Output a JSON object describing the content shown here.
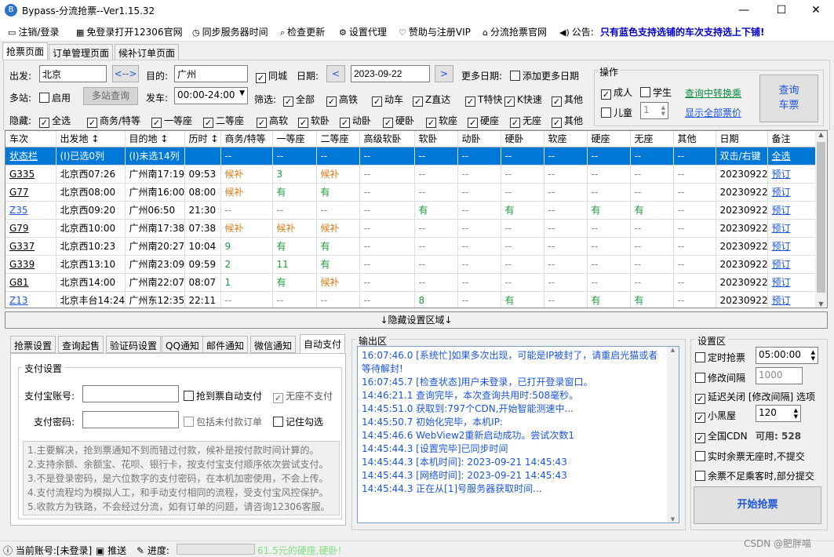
{
  "window": {
    "title": "Bypass-分流抢票--Ver1.15.32"
  },
  "menu": [
    {
      "label": "注销/登录",
      "icon": "login-icon"
    },
    {
      "label": "免登录打开12306官网",
      "icon": "window-icon"
    },
    {
      "label": "同步服务器时间",
      "icon": "clock-icon"
    },
    {
      "label": "检查更新",
      "icon": "search-icon"
    },
    {
      "label": "设置代理",
      "icon": "gear-icon"
    },
    {
      "label": "赞助与注册VIP",
      "icon": "heart-icon"
    },
    {
      "label": "分流抢票官网",
      "icon": "home-icon"
    },
    {
      "label": "公告:",
      "icon": "speaker-icon"
    }
  ],
  "notice": "只有蓝色支持选铺的车次支持选上下铺!",
  "tabs": [
    "抢票页面",
    "订单管理页面",
    "候补订单页面"
  ],
  "query": {
    "from_label": "出发:",
    "from": "北京",
    "swap": "<-->",
    "to_label": "目的:",
    "to": "广州",
    "samecity": "同城",
    "date_label": "日期:",
    "date": "2023-09-22",
    "prev": "<",
    "next": ">",
    "moredates_label": "更多日期:",
    "add_dates": "添加更多日期",
    "multi_label": "多站:",
    "enable": "启用",
    "multi_query": "多站查询",
    "depart_label": "发车:",
    "depart_range": "00:00-24:00",
    "filter_label": "筛选:",
    "filters": [
      "全部",
      "高铁",
      "动车",
      "Z直达",
      "T特快",
      "K快速",
      "其他"
    ],
    "hide_label": "隐藏:",
    "seats": [
      "全选",
      "商务/特等",
      "一等座",
      "二等座",
      "高软",
      "软卧",
      "动卧",
      "硬卧",
      "软座",
      "硬座",
      "无座",
      "其他"
    ],
    "ops_title": "操作",
    "adult": "成人",
    "student": "学生",
    "child": "儿童",
    "child_count": "1",
    "transfer_link": "查询中转换乘",
    "showprice_link": "显示全部票价",
    "query_button": "查询\n车票"
  },
  "table": {
    "headers": [
      "车次",
      "出发地 ↕",
      "目的地 ↕",
      "历时 ↕",
      "商务/特等",
      "一等座",
      "二等座",
      "高级软卧",
      "软卧",
      "动卧",
      "硬卧",
      "软座",
      "硬座",
      "无座",
      "其他",
      "日期",
      "备注"
    ],
    "status_row": [
      "状态栏",
      "(I)已选0列",
      "(I)未选14列",
      "",
      "--",
      "--",
      "--",
      "--",
      "--",
      "--",
      "--",
      "--",
      "--",
      "--",
      "--",
      "双击/右键",
      "全选"
    ],
    "rows": [
      [
        "G335",
        "北京西07:26",
        "广州南17:19",
        "09:53",
        "候补",
        "3",
        "候补",
        "--",
        "--",
        "--",
        "--",
        "--",
        "--",
        "--",
        "--",
        "20230922",
        "预订"
      ],
      [
        "G77",
        "北京西08:00",
        "广州南16:00",
        "08:00",
        "候补",
        "有",
        "有",
        "--",
        "--",
        "--",
        "--",
        "--",
        "--",
        "--",
        "--",
        "20230922",
        "预订"
      ],
      [
        "Z35",
        "北京西09:20",
        "广州06:50",
        "21:30",
        "--",
        "--",
        "--",
        "--",
        "有",
        "--",
        "有",
        "--",
        "有",
        "有",
        "--",
        "20230922",
        "预订"
      ],
      [
        "G79",
        "北京西10:00",
        "广州南17:38",
        "07:38",
        "候补",
        "候补",
        "候补",
        "--",
        "--",
        "--",
        "--",
        "--",
        "--",
        "--",
        "--",
        "20230922",
        "预订"
      ],
      [
        "G337",
        "北京西10:23",
        "广州南20:27",
        "10:04",
        "9",
        "有",
        "有",
        "--",
        "--",
        "--",
        "--",
        "--",
        "--",
        "--",
        "--",
        "20230922",
        "预订"
      ],
      [
        "G339",
        "北京西13:10",
        "广州南23:09",
        "09:59",
        "2",
        "11",
        "有",
        "--",
        "--",
        "--",
        "--",
        "--",
        "--",
        "--",
        "--",
        "20230922",
        "预订"
      ],
      [
        "G81",
        "北京西14:00",
        "广州南22:07",
        "08:07",
        "1",
        "有",
        "候补",
        "--",
        "--",
        "--",
        "--",
        "--",
        "--",
        "--",
        "--",
        "20230922",
        "预订"
      ],
      [
        "Z13",
        "北京丰台14:24",
        "广州东12:35",
        "22:11",
        "--",
        "--",
        "--",
        "--",
        "8",
        "--",
        "有",
        "--",
        "有",
        "有",
        "--",
        "20230922",
        "预订"
      ]
    ]
  },
  "hide_area": "↓隐藏设置区域↓",
  "bottom_tabs": [
    "抢票设置",
    "查询起售",
    "验证码设置",
    "QQ通知",
    "邮件通知",
    "微信通知",
    "自动支付"
  ],
  "pay": {
    "group": "支付设置",
    "alipay_label": "支付宝账号:",
    "pwd_label": "支付密码:",
    "auto_pay": "抢到票自动支付",
    "no_seat": "无座不支付",
    "include_unpaid": "包括未付款订单",
    "remember": "记住勾选",
    "notes": [
      "1.主要解决，抢到票通知不到而错过付款，候补是按付款时间计算的。",
      "2.支持余额、余额宝、花呗、银行卡，按支付宝支付顺序依次尝试支付。",
      "3.不是登录密码，是六位数字的支付密码，在本机加密使用，不会上传。",
      "4.支付流程均为模拟人工，和手动支付相同的流程，受支付宝风控保护。",
      "5.收款方为铁路，不会经过分流，如有订单的问题，请咨询12306客服。"
    ]
  },
  "output": {
    "title": "输出区",
    "lines": [
      "16:07:46.0  [系统忙]如果多次出现，可能是IP被封了，请重启光猫或者",
      "等待解封!",
      "16:07:45.7  [检查状态]用户未登录，已打开登录窗口。",
      "14:46:21.1  查询完毕，本次查询共用时:508毫秒。",
      "14:45:51.0  获取到:797个CDN,开始智能测速中...",
      "14:45:50.7  初始化完毕，本机IP:",
      "14:45:46.6  WebView2重新启动成功。尝试次数1",
      "14:45:44.3  [设置完毕]已同步时间",
      "14:45:44.3  [本机时间]:  2023-09-21 14:45:43",
      "14:45:44.3  [网络时间]:  2023-09-21 14:45:43",
      "14:45:44.3  正在从[1]号服务器获取时间..."
    ]
  },
  "settings": {
    "title": "设置区",
    "timed": "定时抢票",
    "timed_value": "05:00:00",
    "modify_interval": "修改间隔",
    "interval_value": "1000",
    "delay_close": "延迟关闭 [修改间隔] 选项",
    "blacklist": "小黑屋",
    "blacklist_value": "120",
    "cdn": "全国CDN",
    "cdn_avail_label": "可用:",
    "cdn_avail": "528",
    "realtime": "实时余票无座时,不提交",
    "partial": "余票不足乘客时,部分提交",
    "start": "开始抢票"
  },
  "status": {
    "account": "当前账号:[未登录]",
    "push": "推送",
    "progress": "进度:",
    "promo": "61.5元的硬座,硬卧!",
    "watermark": "CSDN @肥胖喵"
  }
}
